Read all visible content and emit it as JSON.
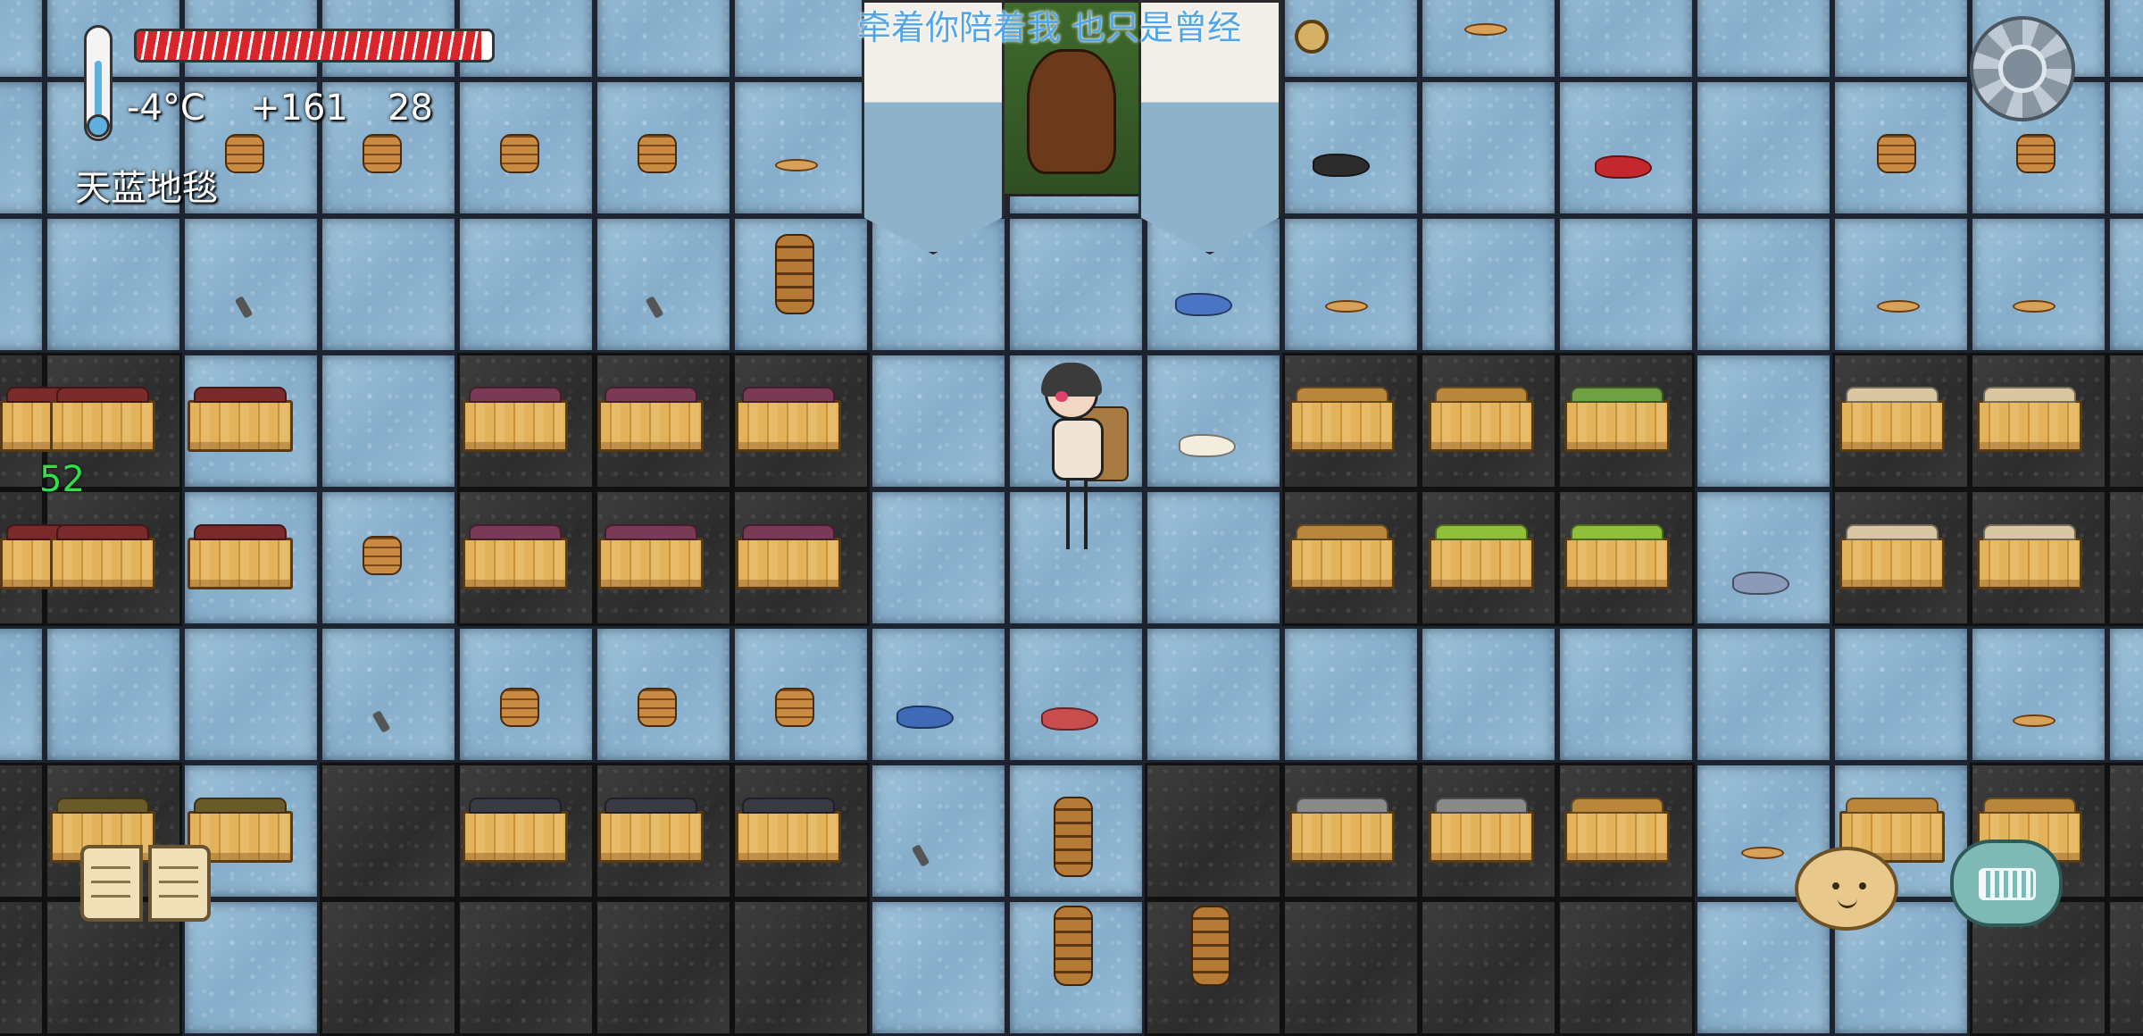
{
  "hud": {
    "temperature": "-4°C",
    "yum_bonus": "+161",
    "age": "28",
    "hover_label": "天蓝地毯",
    "fps": "52",
    "food_level": 0.97
  },
  "speech": {
    "text": "牵着你陪着我 也只是曾经"
  },
  "icons": {
    "thermometer": "thermometer-icon",
    "settings": "gear-icon",
    "recipe_book": "book-icon",
    "emote": "potato-face-icon",
    "keyboard": "keyboard-icon"
  },
  "colors": {
    "carpet": "#9ec2da",
    "soil": "#333333",
    "food_bar": "#d9262c",
    "fps": "#2ee04a",
    "speech": "#52a6e8"
  }
}
